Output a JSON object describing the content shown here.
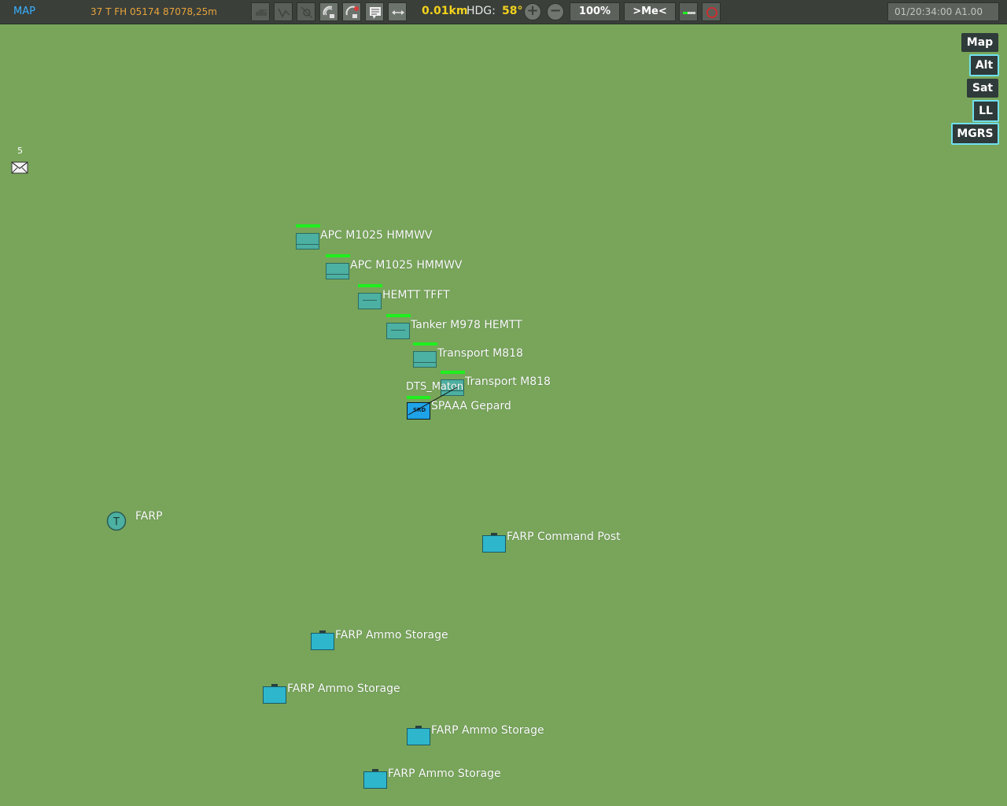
{
  "toolbar": {
    "title": "MAP",
    "coords": "37 T FH 05174 87078,25m",
    "distance": "0.01km",
    "hdg_label": "HDG:",
    "hdg_value": "58°",
    "zoom": "100%",
    "me_button": ">Me<",
    "time": "01/20:34:00 A1.00"
  },
  "layers": {
    "map": "Map",
    "alt": "Alt",
    "sat": "Sat",
    "ll": "LL",
    "mgrs": "MGRS"
  },
  "mail": {
    "count": "5"
  },
  "units": {
    "apc1": "APC M1025 HMMWV",
    "apc2": "APC M1025 HMMWV",
    "hemtt": "HEMTT TFFT",
    "tanker": "Tanker M978 HEMTT",
    "transport1": "Transport M818",
    "transport2": "Transport M818",
    "player": "DTS_Maton",
    "gepard": "SPAAA Gepard",
    "gepard_icon_text": "SRD",
    "farp": "FARP",
    "farp_icon_text": "T",
    "command_post": "FARP Command Post",
    "ammo1": "FARP Ammo Storage",
    "ammo2": "FARP Ammo Storage",
    "ammo3": "FARP Ammo Storage",
    "ammo4": "FARP Ammo Storage"
  },
  "colors": {
    "map_background": "#78a55a",
    "toolbar": "#3a3f3a",
    "accent_yellow": "#f2d21c",
    "health_green": "#1ef01e",
    "ground_unit": "#4cb0a2",
    "static_object": "#2eb6cc",
    "player_unit": "#1fa3e8"
  },
  "icons": [
    "tank-icon",
    "route-icon",
    "satellite-icon",
    "radar-icon",
    "radar-crossed-icon",
    "chat-icon",
    "ruler-icon",
    "zoom-in-icon",
    "zoom-out-icon",
    "gauge-icon",
    "stop-icon",
    "mail-icon"
  ]
}
